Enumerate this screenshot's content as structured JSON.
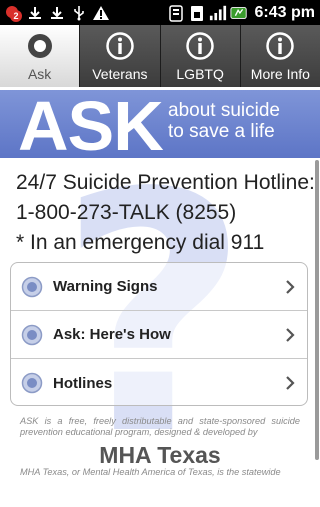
{
  "status_bar": {
    "notification_count": "2",
    "time": "6:43 pm",
    "icons": [
      "notification-icon",
      "download-icon",
      "download-icon",
      "usb-icon",
      "warning-icon",
      "wifi-icon",
      "sim-icon",
      "signal-icon",
      "battery-icon"
    ]
  },
  "tabs": [
    {
      "label": "Ask",
      "icon": "lifebuoy-icon",
      "active": true
    },
    {
      "label": "Veterans",
      "icon": "info-icon",
      "active": false
    },
    {
      "label": "LGBTQ",
      "icon": "info-icon",
      "active": false
    },
    {
      "label": "More Info",
      "icon": "info-icon",
      "active": false
    }
  ],
  "banner": {
    "title": "ASK",
    "tagline_line1": "about suicide",
    "tagline_line2": "to save a life"
  },
  "hotline": {
    "line1": "24/7 Suicide Prevention Hotline:",
    "line2": "1-800-273-TALK (8255)",
    "line3": "* In an emergency dial 911"
  },
  "menu": {
    "items": [
      {
        "label": "Warning Signs"
      },
      {
        "label": "Ask: Here's How"
      },
      {
        "label": "Hotlines"
      }
    ]
  },
  "footer": {
    "description": "ASK is a free, freely distributable and state-sponsored suicide prevention educational program, designed & developed by",
    "logo": "MHA Texas",
    "bottom": "MHA Texas, or Mental Health America of Texas, is the statewide"
  },
  "colors": {
    "banner_top": "#7f95d8",
    "banner_bottom": "#5d75c6",
    "watermark": "#d9dff5",
    "tab_bg": "#4a4a4a",
    "tab_active_bg": "#ffffff"
  }
}
